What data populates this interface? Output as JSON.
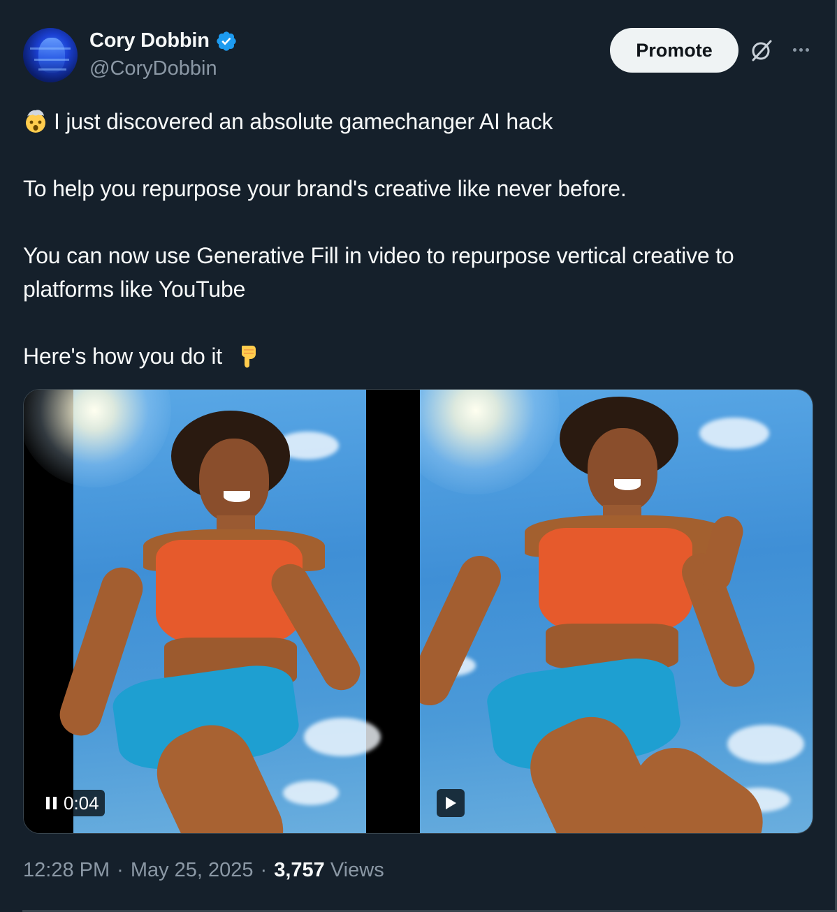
{
  "author": {
    "display_name": "Cory Dobbin",
    "handle": "@CoryDobbin",
    "verified": true
  },
  "actions": {
    "promote_label": "Promote",
    "grok_icon": "grok-icon",
    "more_icon": "more-icon"
  },
  "tweet": {
    "line1": "I just discovered an absolute gamechanger AI hack",
    "line1_emoji": "exploding-head",
    "line2": "To help you repurpose your brand's creative like never before.",
    "line3a": "You can now use Generative Fill in video to repurpose vertical creative to",
    "line3b": "platforms like YouTube",
    "line4": "Here's how you do it",
    "line4_emoji": "pointing-down"
  },
  "media": {
    "video1": {
      "state": "playing",
      "timestamp": "0:04"
    },
    "video2": {
      "state": "paused"
    }
  },
  "footer": {
    "time": "12:28 PM",
    "sep1": "·",
    "date": "May 25, 2025",
    "sep2": "·",
    "views_count": "3,757",
    "views_label": "Views"
  },
  "colors": {
    "background": "#15202b",
    "text": "#f7f9f9",
    "secondary": "#8b98a5",
    "verified": "#1d9bf0",
    "border": "#38444d"
  }
}
